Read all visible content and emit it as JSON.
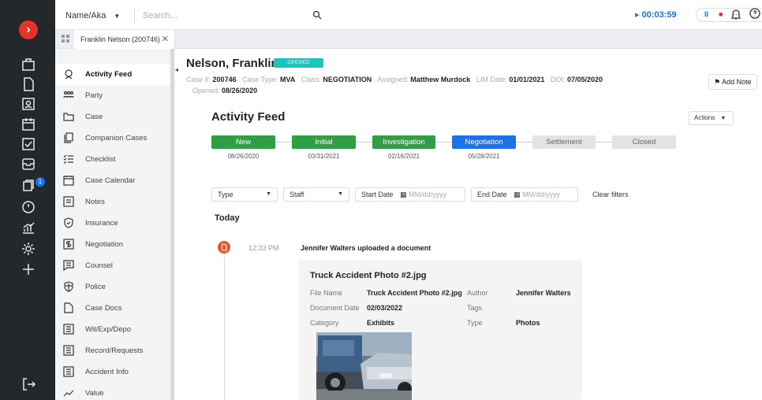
{
  "topbar": {
    "search_type": "Name/Aka",
    "search_placeholder": "Search...",
    "timer": "00:03:59",
    "timer_pause": "II",
    "timer_stop": "■",
    "timer_more": "···"
  },
  "tab": {
    "label": "Franklin Nelson (200746)",
    "close": "✕"
  },
  "sidebar": {
    "items": [
      {
        "label": "Activity Feed",
        "active": true
      },
      {
        "label": "Party"
      },
      {
        "label": "Case"
      },
      {
        "label": "Companion Cases"
      },
      {
        "label": "Checklist"
      },
      {
        "label": "Case Calendar"
      },
      {
        "label": "Notes"
      },
      {
        "label": "Insurance"
      },
      {
        "label": "Negotiation"
      },
      {
        "label": "Counsel"
      },
      {
        "label": "Police"
      },
      {
        "label": "Case Docs"
      },
      {
        "label": "Wit/Exp/Depo"
      },
      {
        "label": "Record/Requests"
      },
      {
        "label": "Accident Info"
      },
      {
        "label": "Value"
      }
    ]
  },
  "rail": {
    "notification_count": "1"
  },
  "case": {
    "name": "Nelson, Franklin",
    "status": "OPENED",
    "case_no_label": "Case #:",
    "case_no": "200746",
    "case_type_label": "Case Type:",
    "case_type": "MVA",
    "class_label": "Class:",
    "class": "NEGOTIATION",
    "assigned_label": "Assigned:",
    "assigned": "Matthew Murdock",
    "lim_label": "LIM Date:",
    "lim": "01/01/2021",
    "doi_label": "DOI:",
    "doi": "07/05/2020",
    "opened_label": "Opened:",
    "opened": "08/26/2020",
    "add_note": "Add Note"
  },
  "feed": {
    "title": "Activity Feed",
    "actions": "Actions",
    "stages": [
      {
        "label": "New",
        "date": "08/26/2020",
        "state": "done"
      },
      {
        "label": "Initial",
        "date": "03/31/2021",
        "state": "done"
      },
      {
        "label": "Investigation",
        "date": "02/16/2021",
        "state": "done"
      },
      {
        "label": "Negotiation",
        "date": "05/28/2021",
        "state": "current"
      },
      {
        "label": "Settlement",
        "date": "",
        "state": "future"
      },
      {
        "label": "Closed",
        "date": "",
        "state": "future"
      }
    ],
    "filters": {
      "type": "Type",
      "staff": "Staff",
      "start_label": "Start Date",
      "start_placeholder": "MM/dd/yyyy",
      "end_label": "End Date",
      "end_placeholder": "MM/dd/yyyy",
      "clear": "Clear filters"
    },
    "group": "Today",
    "event": {
      "time": "12:33 PM",
      "text": "Jennifer Walters uploaded a document",
      "doc_title": "Truck Accident Photo #2.jpg",
      "file_name_label": "File Name",
      "file_name": "Truck Accident Photo #2.jpg",
      "author_label": "Author",
      "author": "Jennifer Walters",
      "doc_date_label": "Document Date",
      "doc_date": "02/03/2022",
      "tags_label": "Tags",
      "tags": "",
      "category_label": "Category",
      "category": "Exhibits",
      "type_label": "Type",
      "type": "Photos"
    }
  },
  "colors": {
    "rail": "#25282b",
    "brand": "#e6332a",
    "done": "#2f9e44",
    "current": "#1a73e8",
    "badge": "#19c7c0"
  }
}
